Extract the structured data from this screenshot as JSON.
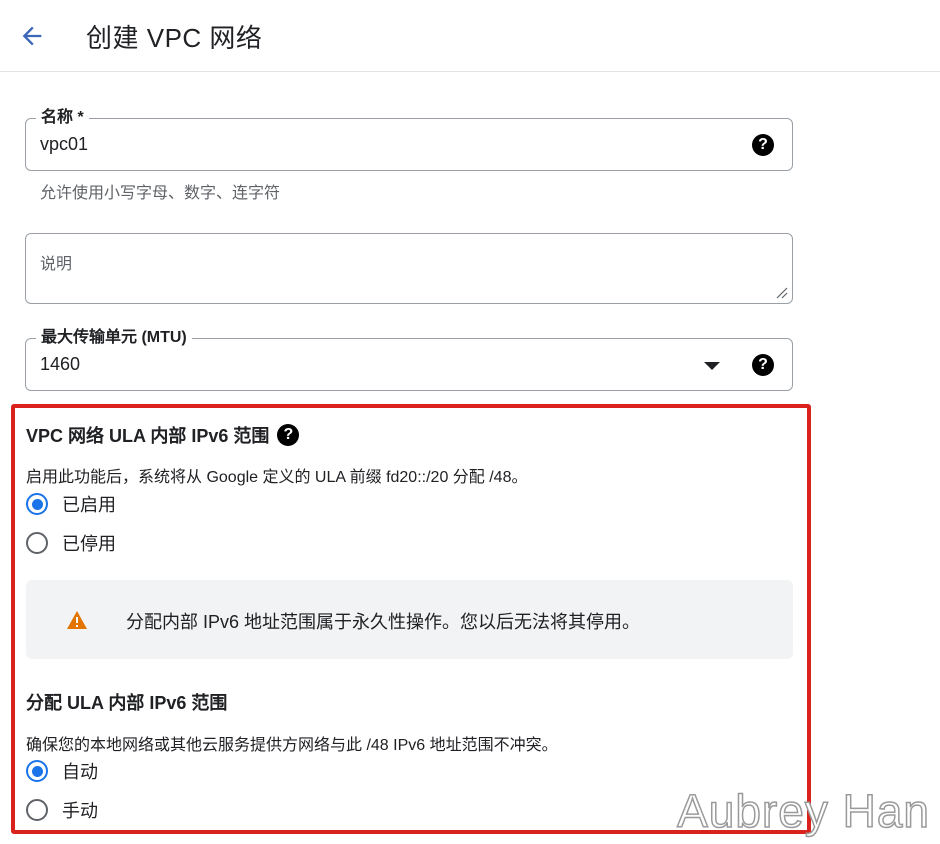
{
  "header": {
    "title": "创建 VPC 网络"
  },
  "name_field": {
    "label": "名称 *",
    "value": "vpc01",
    "hint": "允许使用小写字母、数字、连字符"
  },
  "description_field": {
    "placeholder": "说明"
  },
  "mtu_field": {
    "label": "最大传输单元 (MTU)",
    "value": "1460"
  },
  "ula_section": {
    "title": "VPC 网络 ULA 内部 IPv6 范围",
    "description": "启用此功能后，系统将从 Google 定义的 ULA 前缀 fd20::/20 分配 /48。",
    "options": [
      {
        "label": "已启用",
        "checked": true
      },
      {
        "label": "已停用",
        "checked": false
      }
    ],
    "warning": "分配内部 IPv6 地址范围属于永久性操作。您以后无法将其停用。"
  },
  "allocate_section": {
    "title": "分配 ULA 内部 IPv6 范围",
    "description": "确保您的本地网络或其他云服务提供方网络与此 /48 IPv6 地址范围不冲突。",
    "options": [
      {
        "label": "自动",
        "checked": true
      },
      {
        "label": "手动",
        "checked": false
      }
    ]
  },
  "help_icon_glyph": "?",
  "watermark": "Aubrey Han",
  "colors": {
    "accent": "#1a73e8",
    "highlight_border": "#d9221c",
    "warning": "#e37400"
  }
}
